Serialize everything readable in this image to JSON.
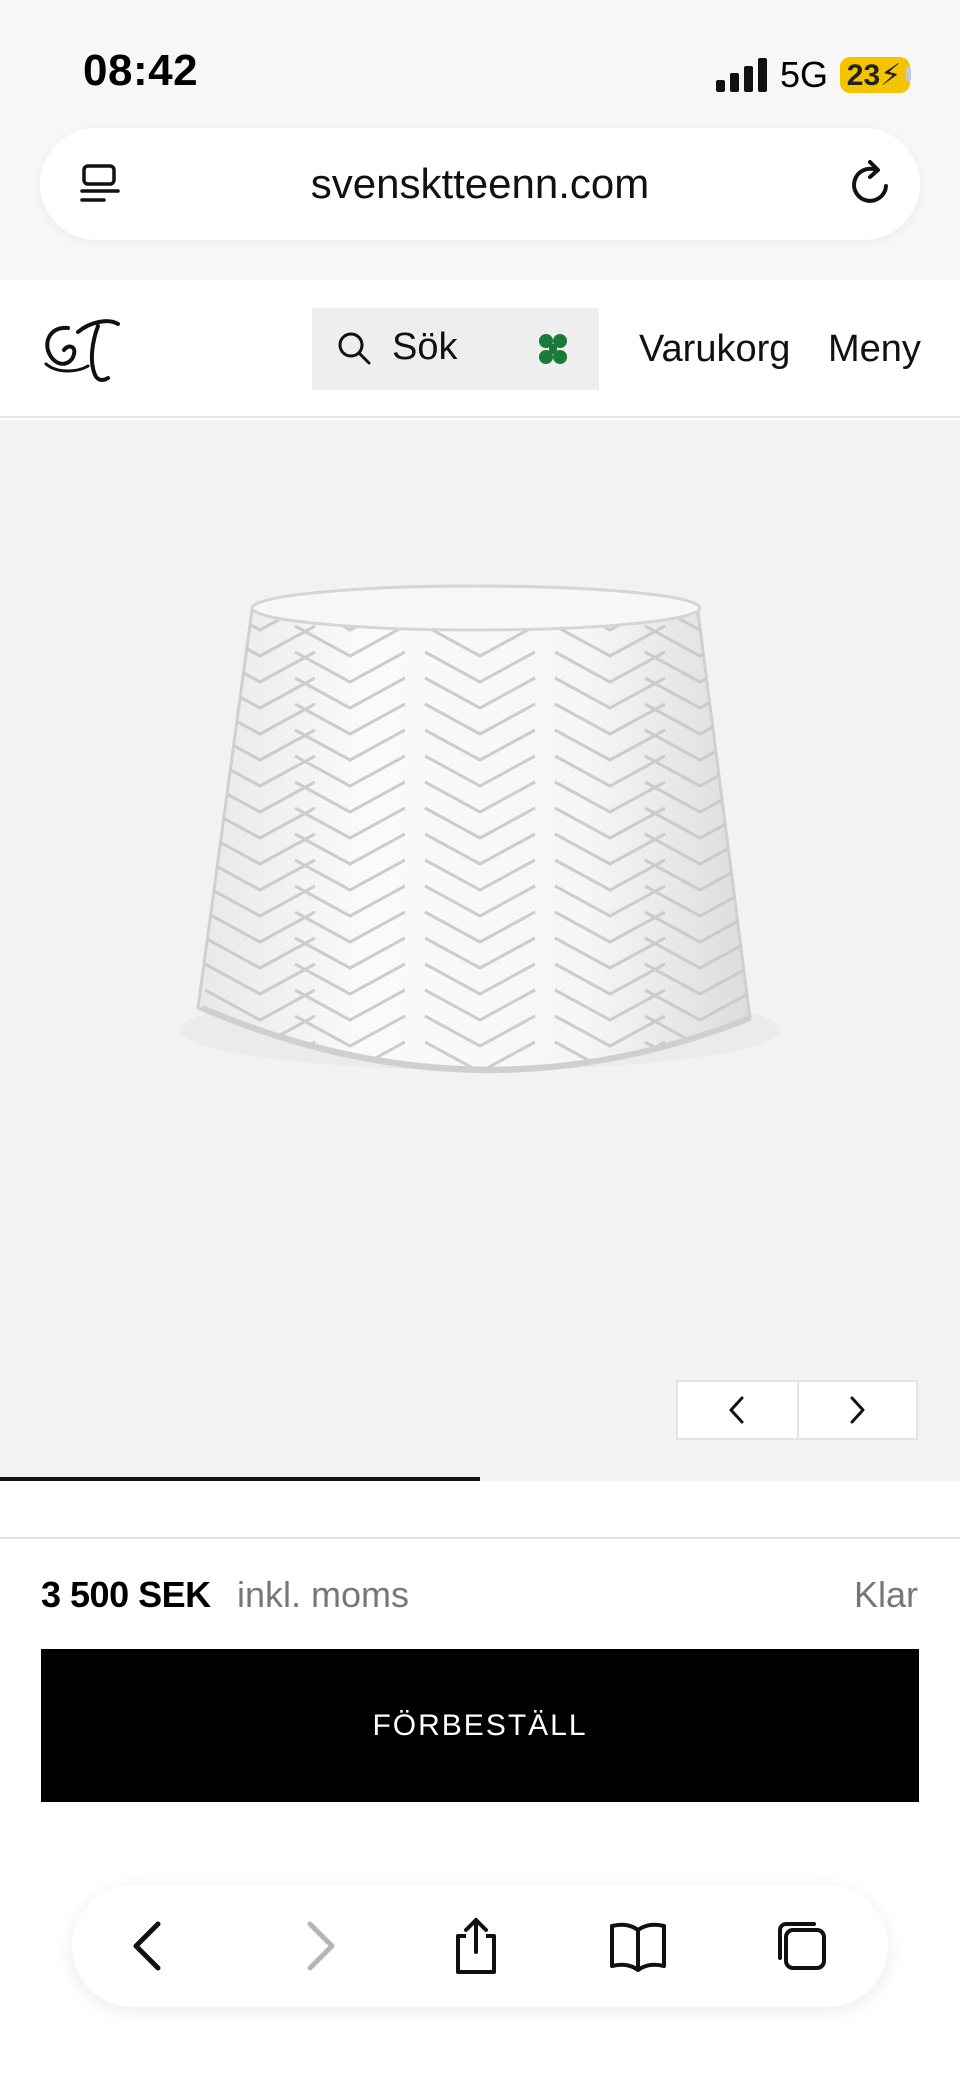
{
  "status_bar": {
    "time": "08:42",
    "network": "5G",
    "battery": "23",
    "battery_color": "#f5c400"
  },
  "browser": {
    "url": "svensktteenn.com",
    "icons": [
      "reader-icon",
      "reload-icon"
    ]
  },
  "header": {
    "logo": "ST",
    "search_label": "Sök",
    "cart_label": "Varukorg",
    "menu_label": "Meny",
    "clover_color": "#1a7a3a"
  },
  "gallery": {
    "image": "chevron-pattern-glass-lampshade",
    "prev_icon": "chevron-left-icon",
    "next_icon": "chevron-right-icon",
    "progress": 0.5
  },
  "purchase": {
    "price": "3 500 SEK",
    "tax_note": "inkl. moms",
    "status": "Klar",
    "cta_label": "FÖRBESTÄLL"
  },
  "toolbar": {
    "items": [
      "back-icon",
      "forward-icon",
      "share-icon",
      "bookmarks-icon",
      "tabs-icon"
    ]
  }
}
